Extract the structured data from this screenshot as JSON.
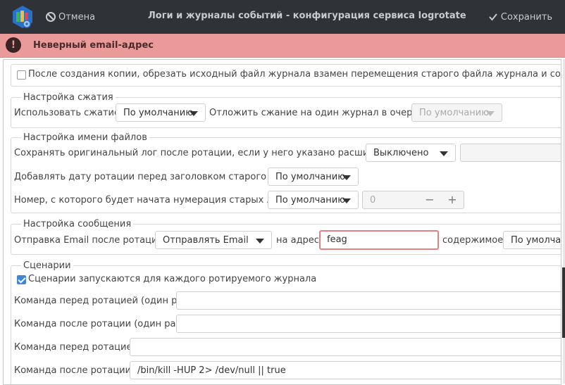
{
  "header": {
    "cancel_label": "Отмена",
    "title": "Логи и журналы событий - конфигурация сервиса logrotate",
    "save_label": "Сохранить"
  },
  "error": {
    "message": "Неверный email-адрес"
  },
  "copytruncate": {
    "label": "После создания копии, обрезать исходный файл журнала взамен перемещения старого файла журнала и создания нового",
    "checked": false
  },
  "compression": {
    "legend": "Настройка сжатия",
    "use_label": "Использовать сжатие:",
    "use_value": "По умолчанию",
    "delay_label": "Отложить сжание на один журнал в очереди:",
    "delay_value": "По умолчанию"
  },
  "filenames": {
    "legend": "Настройка имени файлов",
    "ext_label": "Сохранять оригинальный лог после ротации, если у него указано расширение:",
    "ext_value": "Выключено",
    "ext_text": "",
    "date_label": "Добавлять дату ротации перед заголовком старого лога:",
    "date_value": "По умолчанию",
    "start_label": "Номер, с которого будет начата нумерация старых логов:",
    "start_value": "По умолчанию",
    "start_number": "0",
    "minus": "−",
    "plus": "+"
  },
  "messages": {
    "legend": "Настройка сообщения",
    "mail_label": "Отправка Email после ротации:",
    "mail_value": "Отправлять Email",
    "address_label": "на адрес:",
    "address_value": "feag",
    "content_label": "содержимое:",
    "content_value": "По умолча"
  },
  "scripts": {
    "legend": "Сценарии",
    "shared_label": "Сценарии запускаются для каждого ротируемого журнала",
    "shared_checked": true,
    "pre_once_label": "Команда перед ротацией (один раз):",
    "pre_once_value": "",
    "post_once_label": "Команда после ротации (один раз):",
    "post_once_value": "",
    "pre_label": "Команда перед ротацией:",
    "pre_value": "",
    "post_label": "Команда после ротации:",
    "post_value": "/bin/kill -HUP  2> /dev/null || true"
  },
  "colors": {
    "titlebar": "#2f3236",
    "error_bar": "#eb9a9a",
    "checkbox_accent": "#3f86d6",
    "error_field_border": "#e58080"
  }
}
